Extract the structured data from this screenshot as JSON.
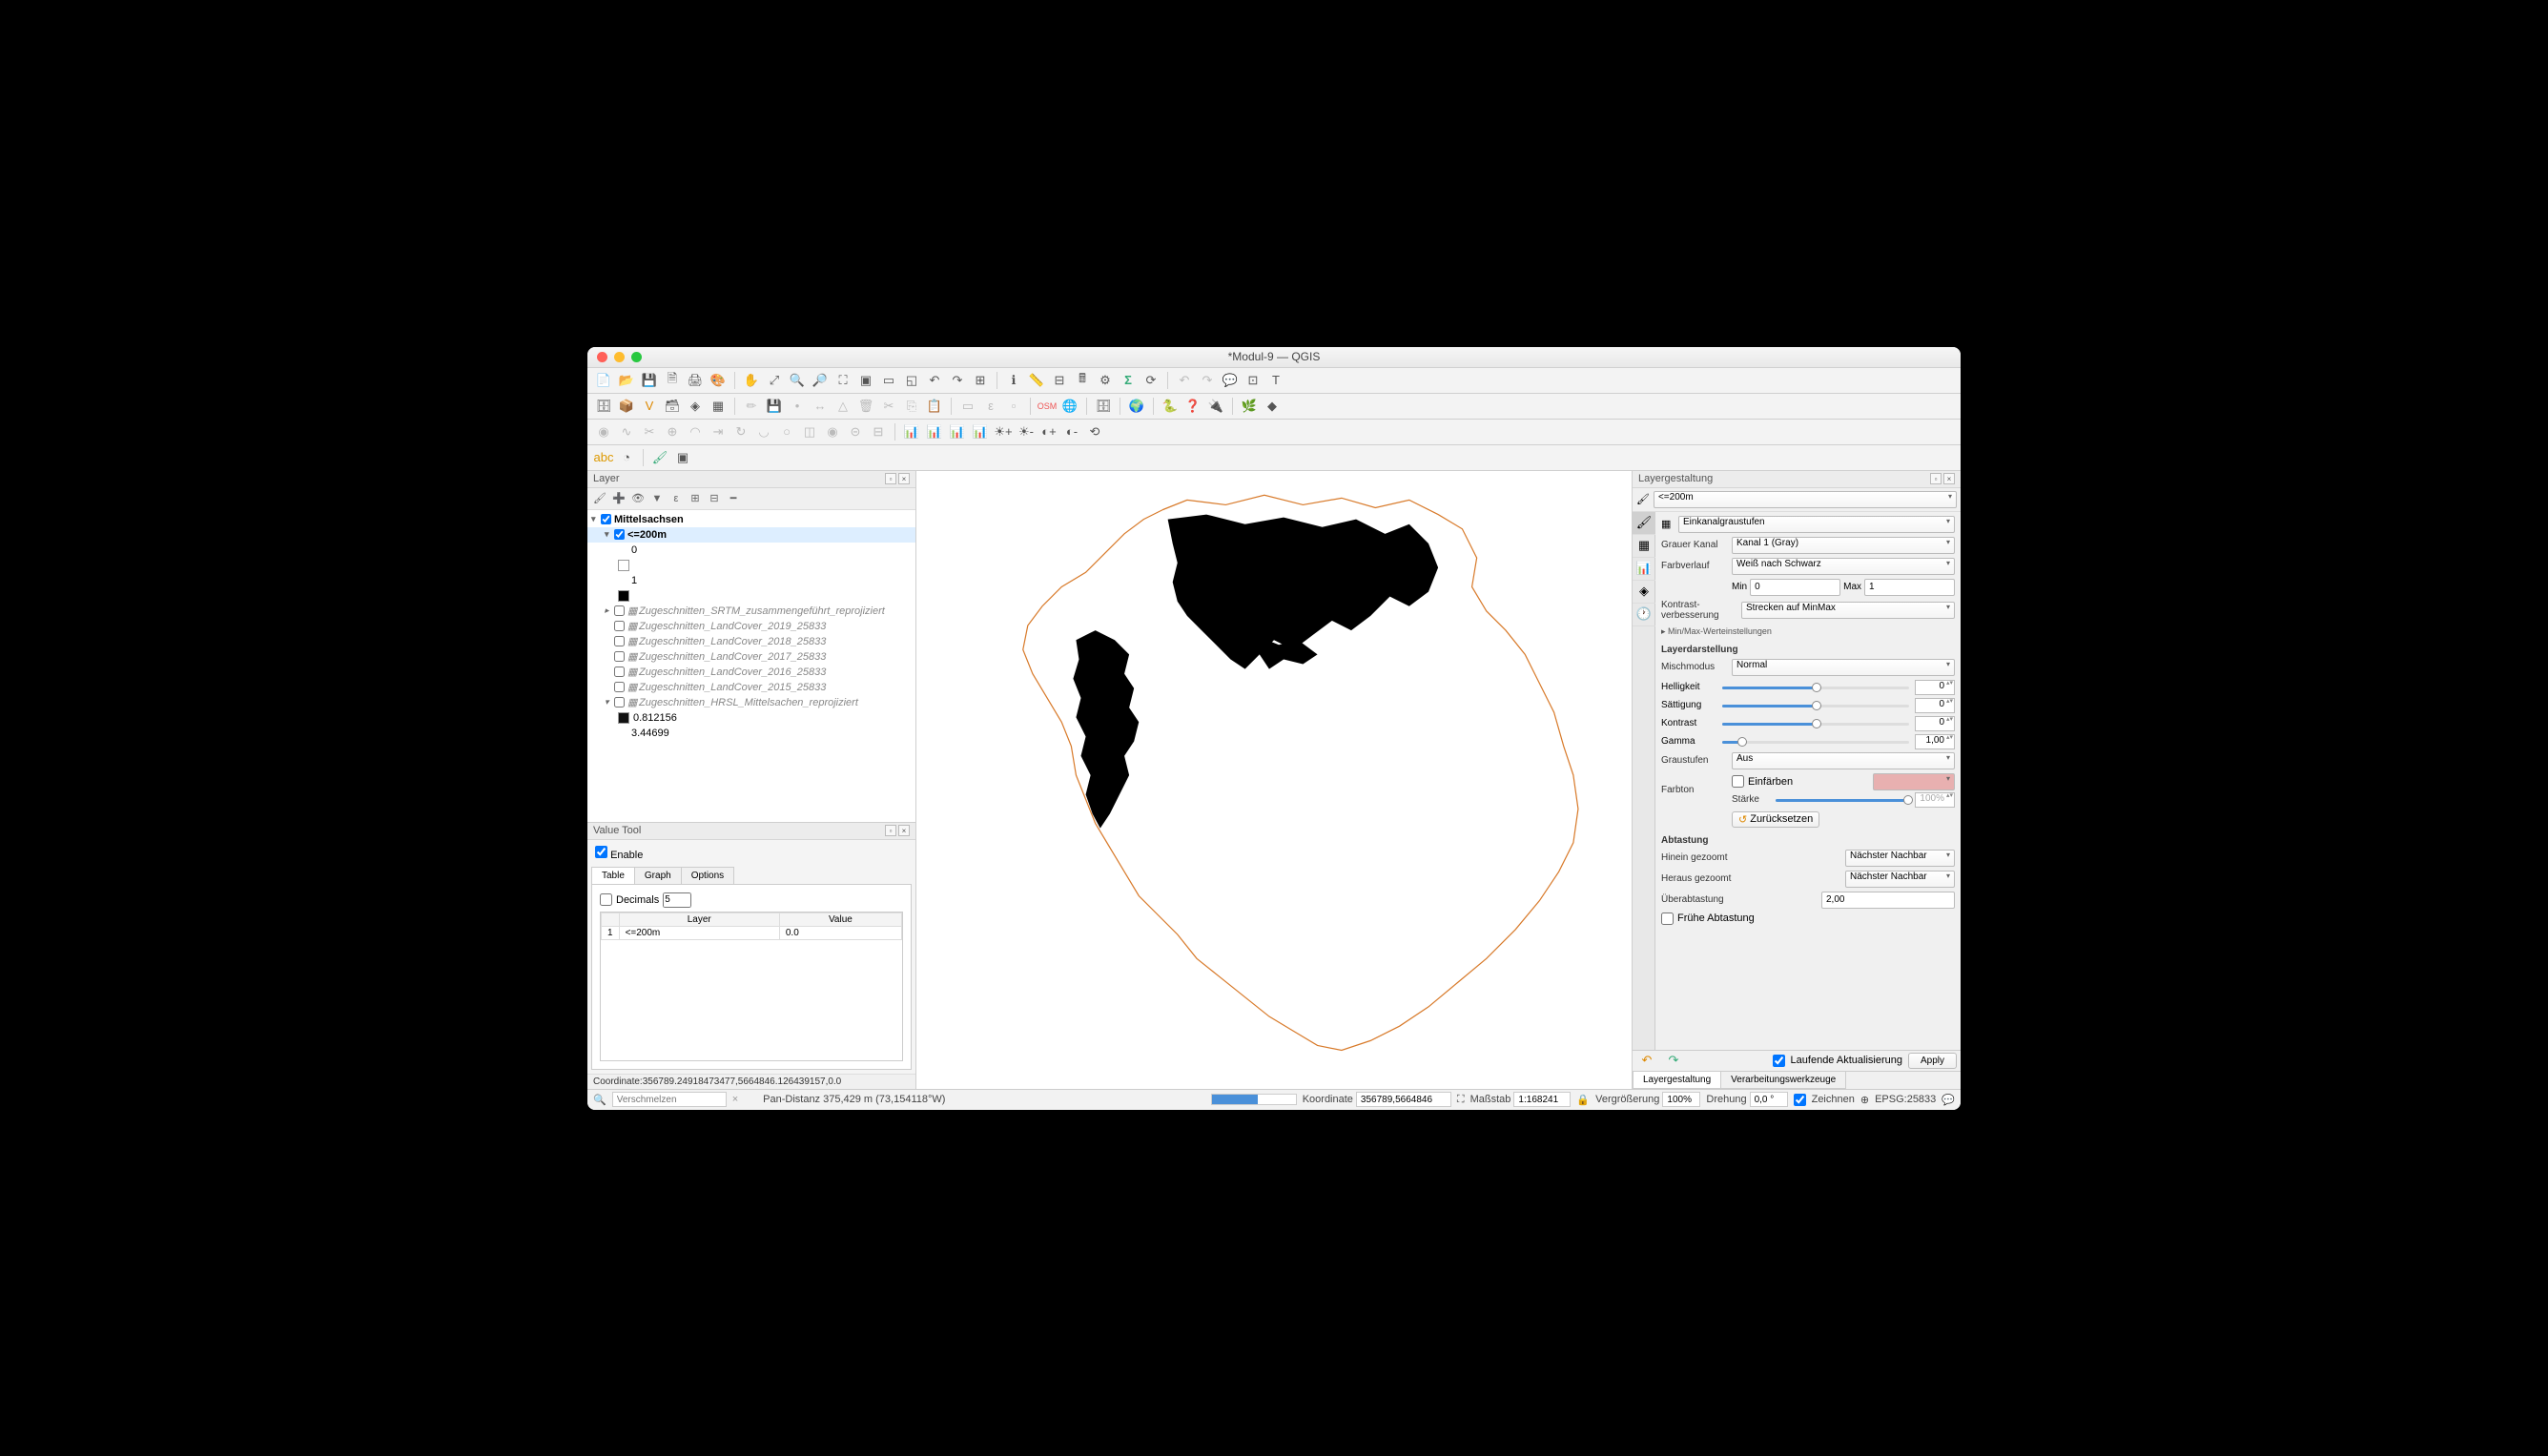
{
  "window": {
    "title": "*Modul-9 — QGIS"
  },
  "panels": {
    "layers_title": "Layer",
    "value_tool_title": "Value Tool",
    "styling_title": "Layergestaltung"
  },
  "layers": {
    "root": "Mittelsachsen",
    "active": "<=200m",
    "legend0": "0",
    "legend1": "1",
    "items": [
      "Zugeschnitten_SRTM_zusammengeführt_reprojiziert",
      "Zugeschnitten_LandCover_2019_25833",
      "Zugeschnitten_LandCover_2018_25833",
      "Zugeschnitten_LandCover_2017_25833",
      "Zugeschnitten_LandCover_2016_25833",
      "Zugeschnitten_LandCover_2015_25833",
      "Zugeschnitten_HRSL_Mittelsachen_reprojiziert"
    ],
    "hrsl_v0": "0.812156",
    "hrsl_v1": "3.44699"
  },
  "value_tool": {
    "enable": "Enable",
    "tabs": {
      "table": "Table",
      "graph": "Graph",
      "options": "Options"
    },
    "decimals_label": "Decimals",
    "decimals_value": "5",
    "cols": {
      "layer": "Layer",
      "value": "Value"
    },
    "row_idx": "1",
    "row_layer": "<=200m",
    "row_value": "0.0",
    "coord": "Coordinate:356789.24918473477,5664846.126439157,0.0"
  },
  "styling": {
    "layer": "<=200m",
    "renderer": "Einkanalgraustufen",
    "gray_band_label": "Grauer Kanal",
    "gray_band_value": "Kanal 1 (Gray)",
    "gradient_label": "Farbverlauf",
    "gradient_value": "Weiß nach Schwarz",
    "min_label": "Min",
    "min_value": "0",
    "max_label": "Max",
    "max_value": "1",
    "contrast_label": "Kontrast-verbesserung",
    "contrast_value": "Strecken auf MinMax",
    "minmax_section": "Min/Max-Werteinstellungen",
    "rendering_title": "Layerdarstellung",
    "blend_label": "Mischmodus",
    "blend_value": "Normal",
    "brightness_label": "Helligkeit",
    "brightness_value": "0",
    "saturation_label": "Sättigung",
    "saturation_value": "0",
    "contrast2_label": "Kontrast",
    "contrast2_value": "0",
    "gamma_label": "Gamma",
    "gamma_value": "1,00",
    "grayscale_label": "Graustufen",
    "grayscale_value": "Aus",
    "hue_label": "Farbton",
    "colorize_label": "Einfärben",
    "strength_label": "Stärke",
    "strength_value": "100%",
    "reset": "Zurücksetzen",
    "resampling_title": "Abtastung",
    "zoom_in_label": "Hinein gezoomt",
    "zoom_in_value": "Nächster Nachbar",
    "zoom_out_label": "Heraus gezoomt",
    "zoom_out_value": "Nächster Nachbar",
    "oversample_label": "Überabtastung",
    "oversample_value": "2,00",
    "early_resample": "Frühe Abtastung",
    "live_update": "Laufende Aktualisierung",
    "apply": "Apply",
    "bottom_tabs": {
      "styling": "Layergestaltung",
      "processing": "Verarbeitungswerkzeuge"
    }
  },
  "statusbar": {
    "locator_placeholder": "Verschmelzen",
    "pan": "Pan-Distanz 375,429 m (73,154118°W)",
    "coord_label": "Koordinate",
    "coord_value": "356789,5664846",
    "scale_label": "Maßstab",
    "scale_value": "1:168241",
    "mag_label": "Vergrößerung",
    "mag_value": "100%",
    "rot_label": "Drehung",
    "rot_value": "0,0 °",
    "render_label": "Zeichnen",
    "crs": "EPSG:25833"
  }
}
